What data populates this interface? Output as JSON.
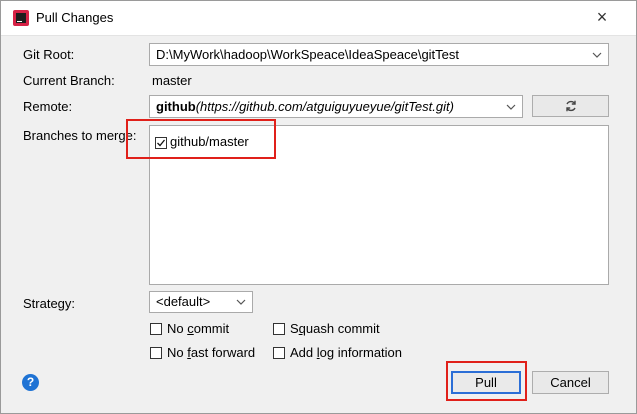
{
  "window": {
    "title": "Pull Changes"
  },
  "form": {
    "git_root_label": "Git Root:",
    "git_root_value": "D:\\MyWork\\hadoop\\WorkSpeace\\IdeaSpeace\\gitTest",
    "current_branch_label": "Current Branch:",
    "current_branch_value": "master",
    "remote_label": "Remote:",
    "remote_name": "github",
    "remote_url": "(https://github.com/atguiguyueyue/gitTest.git)",
    "branches_label": "Branches to merge:",
    "branches": [
      {
        "label": "github/master",
        "checked": true
      }
    ],
    "strategy_label": "Strategy:",
    "strategy_value": "<default>"
  },
  "options": {
    "no_commit": {
      "pre": "No ",
      "mnemonic": "c",
      "post": "ommit",
      "checked": false
    },
    "squash_commit": {
      "pre": "S",
      "mnemonic": "q",
      "post": "uash commit",
      "checked": false
    },
    "no_fast_forward": {
      "pre": "No ",
      "mnemonic": "f",
      "post": "ast forward",
      "checked": false
    },
    "add_log": {
      "pre": "Add ",
      "mnemonic": "l",
      "post": "og information",
      "checked": false
    }
  },
  "buttons": {
    "pull": "Pull",
    "cancel": "Cancel"
  },
  "icons": {
    "app": "intellij-icon",
    "close": "close-icon",
    "refresh": "refresh-icon",
    "help": "help-icon",
    "dropdown": "chevron-down-icon"
  },
  "colors": {
    "highlight": "#e0201a",
    "help": "#1f73d4",
    "primary_border": "#2b6ed6"
  }
}
